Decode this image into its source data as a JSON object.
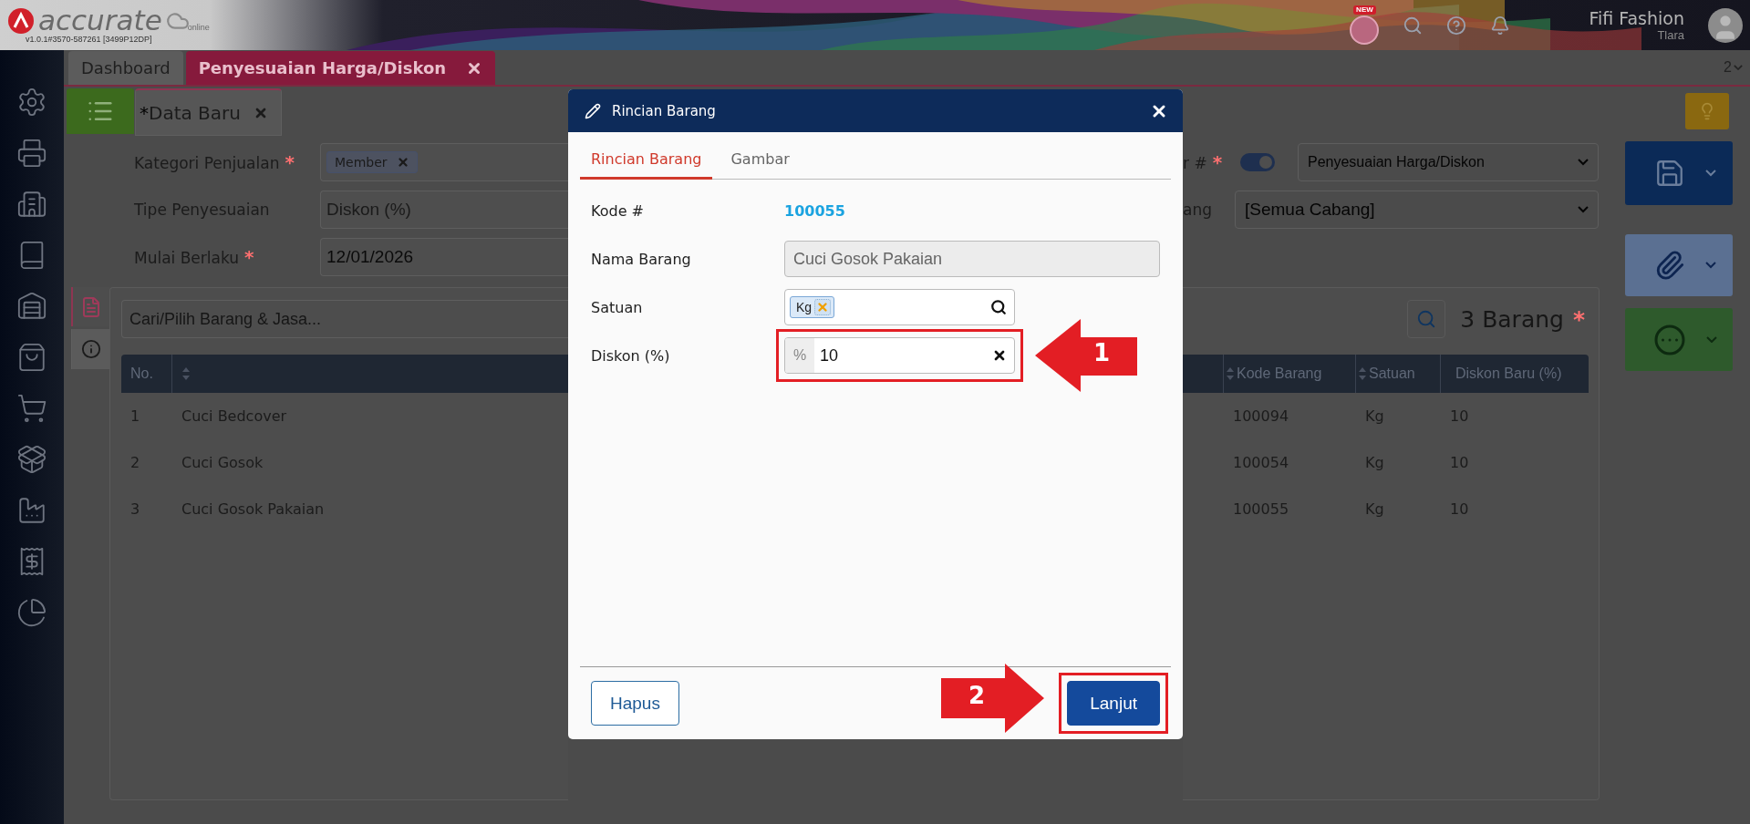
{
  "app": {
    "logo": "accurate",
    "logo_sub": "online",
    "version": "v1.0.1#3570-587261 [3499P12DP]",
    "new_badge": "NEW",
    "company": "Fifi Fashion",
    "user": "Tlara"
  },
  "required_mark": "*",
  "tabs": [
    {
      "label": "Dashboard",
      "selected": false,
      "closable": false
    },
    {
      "label": "Penyesuaian Harga/Diskon",
      "selected": true,
      "closable": true
    }
  ],
  "tab_count": "2",
  "subtab": {
    "marker": "*",
    "label": "Data Baru"
  },
  "form_left": [
    {
      "label": "Kategori Penjualan",
      "required": true,
      "kind": "chip",
      "value": "Member"
    },
    {
      "label": "Tipe Penyesuaian",
      "required": false,
      "kind": "readonly",
      "value": "Diskon (%)"
    },
    {
      "label": "Mulai Berlaku",
      "required": true,
      "kind": "text",
      "value": "12/01/2026"
    }
  ],
  "form_right": [
    {
      "label": "r #",
      "required": true,
      "toggle_on": true,
      "value": "Penyesuaian Harga/Diskon"
    },
    {
      "label": "ang",
      "required": false,
      "value": "[Semua Cabang]"
    }
  ],
  "items": {
    "search_placeholder": "Cari/Pilih Barang & Jasa...",
    "count": "3 Barang",
    "required": true,
    "columns": {
      "no": "No.",
      "code": "Kode Barang",
      "unit": "Satuan",
      "discount": "Diskon Baru (%)"
    },
    "rows": [
      {
        "no": "1",
        "name": "Cuci Bedcover",
        "code": "100094",
        "unit": "Kg",
        "discount": "10"
      },
      {
        "no": "2",
        "name": "Cuci Gosok",
        "code": "100054",
        "unit": "Kg",
        "discount": "10"
      },
      {
        "no": "3",
        "name": "Cuci Gosok Pakaian",
        "code": "100055",
        "unit": "Kg",
        "discount": "10"
      }
    ]
  },
  "dialog": {
    "title": "Rincian Barang",
    "tabs": [
      {
        "label": "Rincian Barang",
        "selected": true
      },
      {
        "label": "Gambar",
        "selected": false
      }
    ],
    "fields": [
      {
        "kind": "link",
        "label": "Kode #",
        "value": "100055"
      },
      {
        "kind": "readonly",
        "label": "Nama Barang",
        "value": "Cuci Gosok Pakaian"
      },
      {
        "kind": "chip",
        "label": "Satuan",
        "value": "Kg"
      },
      {
        "kind": "percent",
        "label": "Diskon (%)",
        "prefix": "%",
        "value": "10",
        "callout": "1"
      }
    ],
    "buttons": [
      {
        "label": "Hapus",
        "kind": "secondary"
      },
      {
        "label": "Lanjut",
        "kind": "primary",
        "callout": "2"
      }
    ]
  }
}
